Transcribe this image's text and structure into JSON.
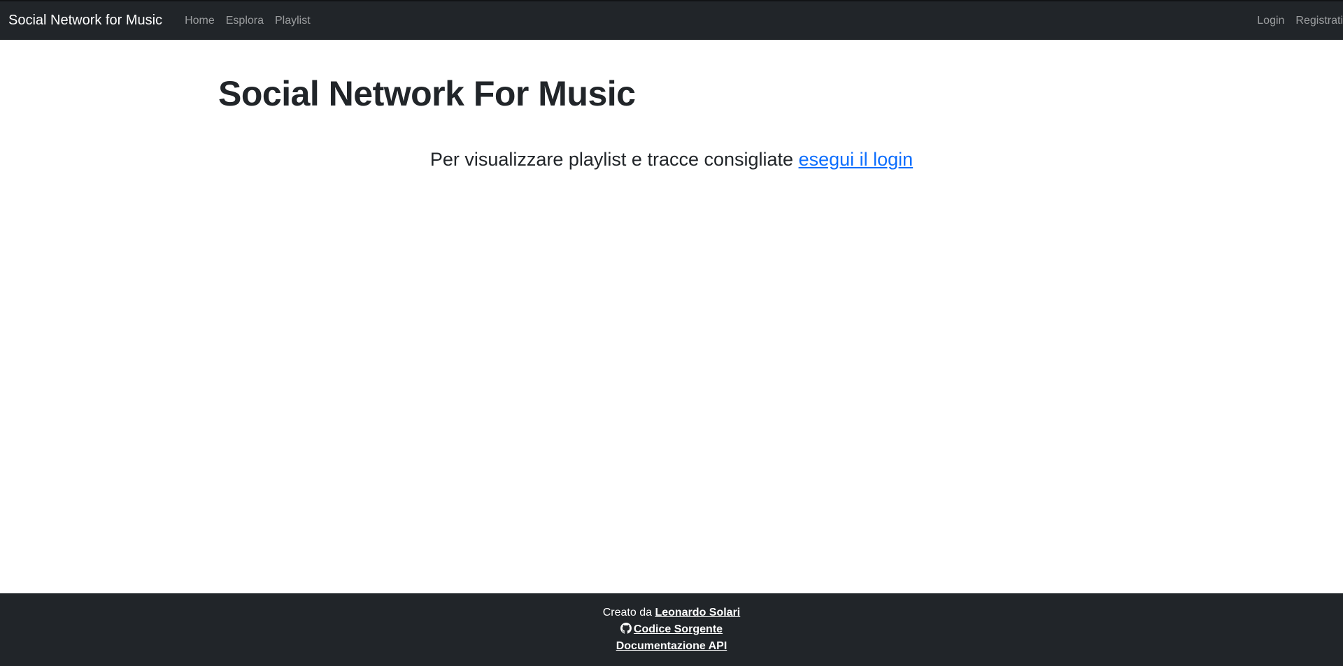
{
  "navbar": {
    "brand": "Social Network for Music",
    "left_items": [
      "Home",
      "Esplora",
      "Playlist"
    ],
    "right_items": [
      "Login",
      "Registrati"
    ]
  },
  "main": {
    "title": "Social Network For Music",
    "notice_text": "Per visualizzare playlist e tracce consigliate ",
    "notice_link": "esegui il login"
  },
  "footer": {
    "created_prefix": "Creato da ",
    "author": "Leonardo Solari",
    "source_link": "Codice Sorgente",
    "api_link": "Documentazione API",
    "source_icon": "github-icon"
  },
  "colors": {
    "navbar_bg": "#212529",
    "link_blue": "#0d6efd",
    "text": "#212529"
  }
}
